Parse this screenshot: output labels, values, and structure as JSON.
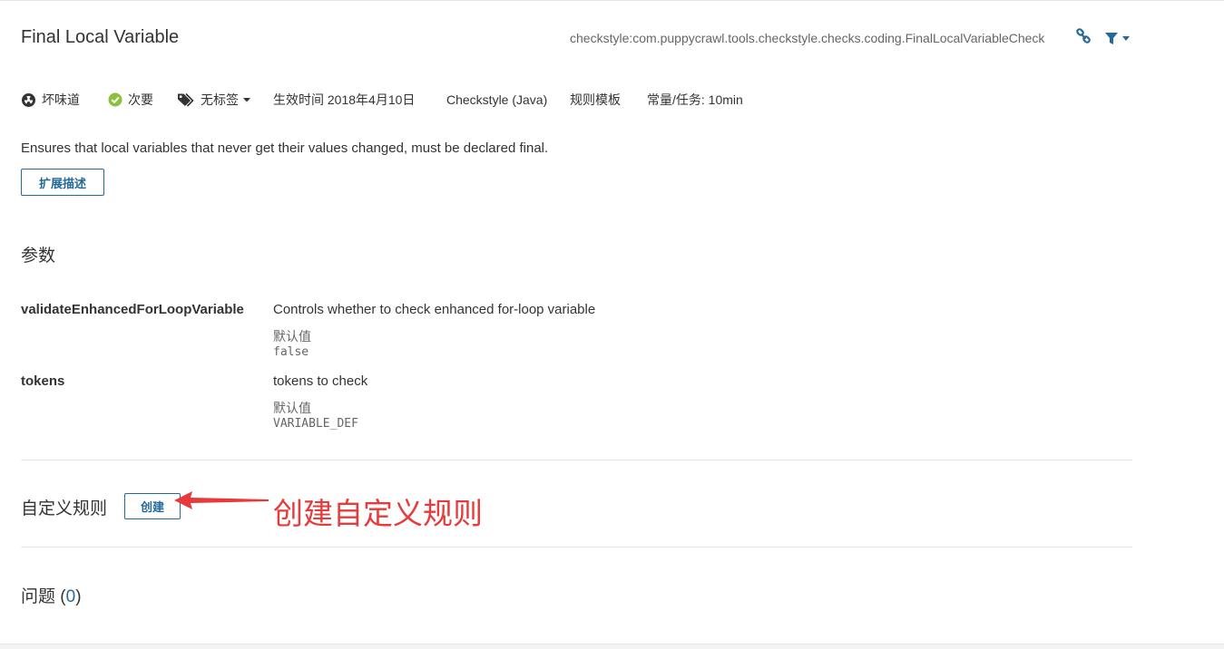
{
  "rule": {
    "title": "Final Local Variable",
    "key": "checkstyle:com.puppycrawl.tools.checkstyle.checks.coding.FinalLocalVariableCheck"
  },
  "meta": {
    "type": "坏味道",
    "severity": "次要",
    "tags": "无标签",
    "effective": "生效时间 2018年4月10日",
    "language": "Checkstyle (Java)",
    "template": "规则模板",
    "effort": "常量/任务: 10min"
  },
  "description": "Ensures that local variables that never get their values changed, must be declared final.",
  "extend_button": "扩展描述",
  "params": {
    "title": "参数",
    "items": [
      {
        "name": "validateEnhancedForLoopVariable",
        "desc": "Controls whether to check enhanced for-loop variable",
        "default_label": "默认值",
        "default_value": "false"
      },
      {
        "name": "tokens",
        "desc": "tokens to check",
        "default_label": "默认值",
        "default_value": "VARIABLE_DEF"
      }
    ]
  },
  "custom_rules": {
    "title": "自定义规则",
    "create_button": "创建"
  },
  "annotation": {
    "text": "创建自定义规则",
    "color": "#e83a3a"
  },
  "issues": {
    "label": "问题",
    "open_paren": "(",
    "count": "0",
    "close_paren": ")"
  },
  "colors": {
    "accent": "#236a97",
    "severity_ok": "#8cbf3f"
  }
}
